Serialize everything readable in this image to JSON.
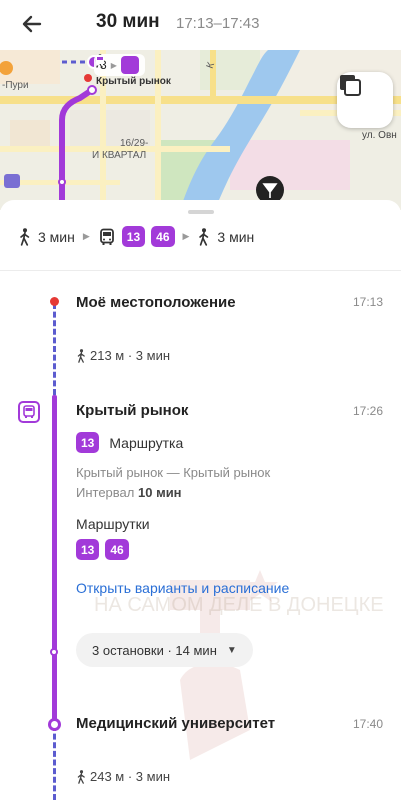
{
  "header": {
    "title": "30 мин",
    "time_range": "17:13–17:43"
  },
  "map": {
    "labels": {
      "puri": "-Пури",
      "kryty": "Крытый рынок",
      "quarter": "16/29-",
      "quarter2": "И КВАРТАЛ",
      "street": "ул. Овн",
      "k": "К"
    },
    "chip_walk_count": "3"
  },
  "summary": {
    "walk1": "3 мин",
    "routes": [
      "13",
      "46"
    ],
    "walk2": "3 мин"
  },
  "timeline": {
    "origin": {
      "title": "Моё местоположение",
      "time": "17:13"
    },
    "walk1": "213 м · 3 мин",
    "board": {
      "title": "Крытый рынок",
      "time": "17:26"
    },
    "selected_route": {
      "number": "13",
      "type": "Маршрутка"
    },
    "direction": "Крытый рынок — Крытый рынок",
    "interval_label": "Интервал",
    "interval_value": "10 мин",
    "alt_label": "Маршрутки",
    "alt_routes": [
      "13",
      "46"
    ],
    "link": "Открыть варианты и расписание",
    "stops_summary": "3 остановки · 14 мин",
    "destination": {
      "title": "Медицинский университет",
      "time": "17:40"
    },
    "walk2": "243 м · 3 мин"
  },
  "watermark": "НА САМОМ ДЕЛЕ В ДОНЕЦКЕ",
  "colors": {
    "accent": "#a23ad9",
    "link": "#2a6fd6",
    "walk_line": "#5c5ccf",
    "origin_dot": "#e53935"
  }
}
